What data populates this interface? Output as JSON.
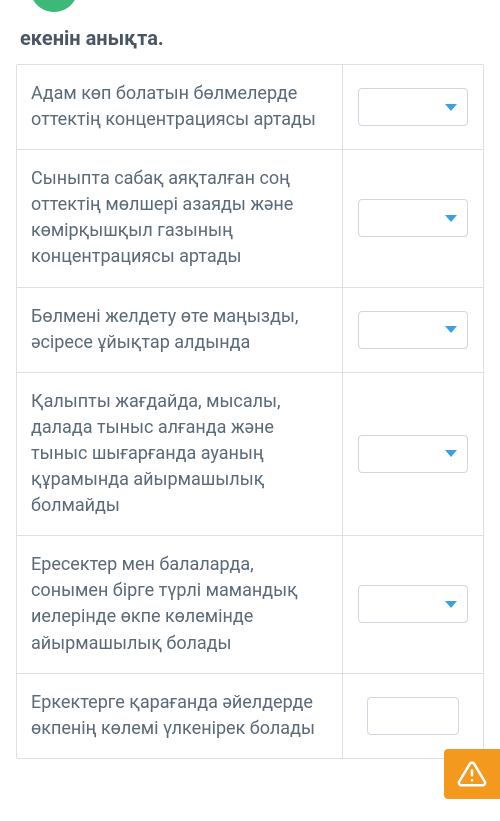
{
  "instruction": "екенін анықта.",
  "rows": [
    {
      "text": "Адам көп болатын бөлмелерде оттектің концентрациясы артады"
    },
    {
      "text": "Сыныпта сабақ аяқталған соң оттектің мөлшері азаяды және көмірқышқыл газының концентрациясы артады"
    },
    {
      "text": "Бөлмені желдету өте маңызды, әсіресе ұйықтар алдында"
    },
    {
      "text": "Қалыпты жағдайда, мысалы, далада тыныс алғанда және тыныс шығарғанда ауаның құрамында айырмашылық болмайды"
    },
    {
      "text": "Ересектер мен балаларда, сонымен бірге түрлі мамандық иелерінде өкпе көлемінде айырмашылық болады"
    },
    {
      "text": "Еркектерге қарағанда әйелдерде өкпенің көлемі үлкенірек болады"
    }
  ],
  "colors": {
    "chevron": "#3b9fe0",
    "alert_bg": "#f39a1e",
    "green": "#3cb878"
  }
}
